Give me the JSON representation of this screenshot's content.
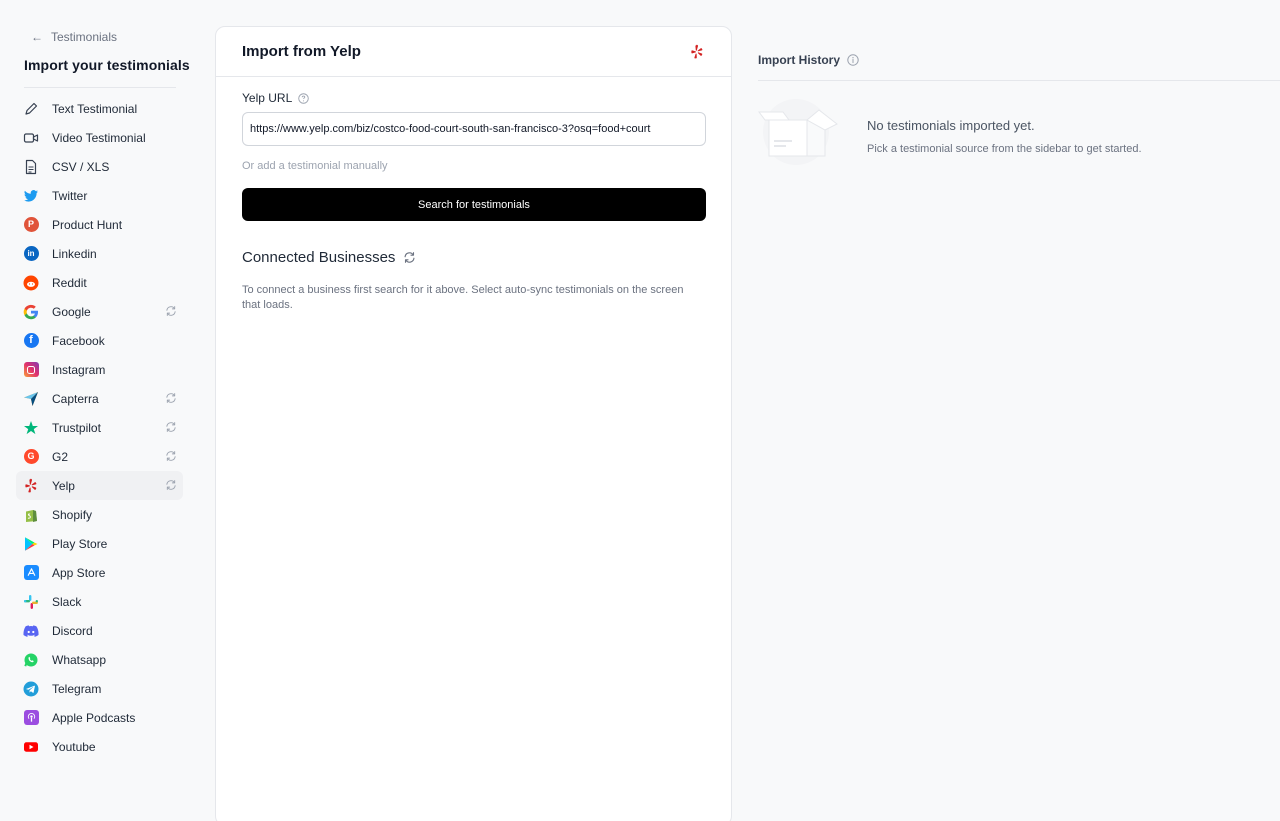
{
  "sidebar": {
    "back_label": "Testimonials",
    "title": "Import your testimonials",
    "items": [
      {
        "label": "Text Testimonial",
        "icon": "pencil-icon",
        "sync": false,
        "active": false
      },
      {
        "label": "Video Testimonial",
        "icon": "video-icon",
        "sync": false,
        "active": false
      },
      {
        "label": "CSV / XLS",
        "icon": "file-icon",
        "sync": false,
        "active": false
      },
      {
        "label": "Twitter",
        "icon": "twitter-icon",
        "sync": false,
        "active": false
      },
      {
        "label": "Product Hunt",
        "icon": "product-hunt-icon",
        "sync": false,
        "active": false
      },
      {
        "label": "Linkedin",
        "icon": "linkedin-icon",
        "sync": false,
        "active": false
      },
      {
        "label": "Reddit",
        "icon": "reddit-icon",
        "sync": false,
        "active": false
      },
      {
        "label": "Google",
        "icon": "google-icon",
        "sync": true,
        "active": false
      },
      {
        "label": "Facebook",
        "icon": "facebook-icon",
        "sync": false,
        "active": false
      },
      {
        "label": "Instagram",
        "icon": "instagram-icon",
        "sync": false,
        "active": false
      },
      {
        "label": "Capterra",
        "icon": "capterra-icon",
        "sync": true,
        "active": false
      },
      {
        "label": "Trustpilot",
        "icon": "trustpilot-icon",
        "sync": true,
        "active": false
      },
      {
        "label": "G2",
        "icon": "g2-icon",
        "sync": true,
        "active": false
      },
      {
        "label": "Yelp",
        "icon": "yelp-icon",
        "sync": true,
        "active": true
      },
      {
        "label": "Shopify",
        "icon": "shopify-icon",
        "sync": false,
        "active": false
      },
      {
        "label": "Play Store",
        "icon": "play-store-icon",
        "sync": false,
        "active": false
      },
      {
        "label": "App Store",
        "icon": "app-store-icon",
        "sync": false,
        "active": false
      },
      {
        "label": "Slack",
        "icon": "slack-icon",
        "sync": false,
        "active": false
      },
      {
        "label": "Discord",
        "icon": "discord-icon",
        "sync": false,
        "active": false
      },
      {
        "label": "Whatsapp",
        "icon": "whatsapp-icon",
        "sync": false,
        "active": false
      },
      {
        "label": "Telegram",
        "icon": "telegram-icon",
        "sync": false,
        "active": false
      },
      {
        "label": "Apple Podcasts",
        "icon": "apple-podcasts-icon",
        "sync": false,
        "active": false
      },
      {
        "label": "Youtube",
        "icon": "youtube-icon",
        "sync": false,
        "active": false
      }
    ]
  },
  "panel": {
    "title": "Import from Yelp",
    "url_label": "Yelp URL",
    "url_value": "https://www.yelp.com/biz/costco-food-court-south-san-francisco-3?osq=food+court",
    "manual_link": "Or add a testimonial manually",
    "search_button": "Search for testimonials",
    "connected_title": "Connected Businesses",
    "connected_desc": "To connect a business first search for it above. Select auto-sync testimonials on the screen that loads."
  },
  "history": {
    "title": "Import History",
    "empty_title": "No testimonials imported yet.",
    "empty_desc": "Pick a testimonial source from the sidebar to get started."
  },
  "colors": {
    "yelp_red": "#d32323",
    "button_bg": "#000000",
    "active_bg": "#f0f1f3"
  }
}
